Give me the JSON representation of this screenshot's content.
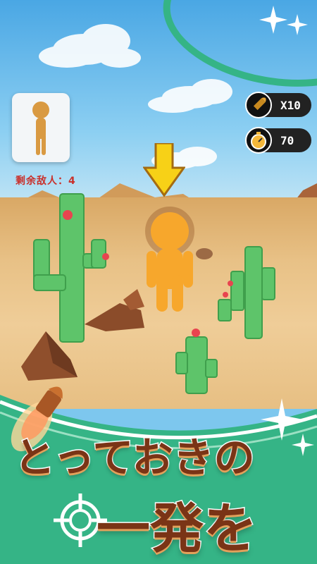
{
  "hud": {
    "enemies_remaining": "剩余敌人：4",
    "ammo": "X10",
    "timer": "70"
  },
  "promo": {
    "line1": "とっておきの",
    "line2": "一発を"
  },
  "icons": {
    "ammo": "bullet-icon",
    "timer": "stopwatch-icon",
    "target": "crosshair-icon",
    "indicator": "down-arrow-icon"
  },
  "colors": {
    "enemy": "#f5a623",
    "arrow": "#f7d117",
    "enemy_count_text": "#c9302b",
    "promo_green": "#35b486"
  }
}
